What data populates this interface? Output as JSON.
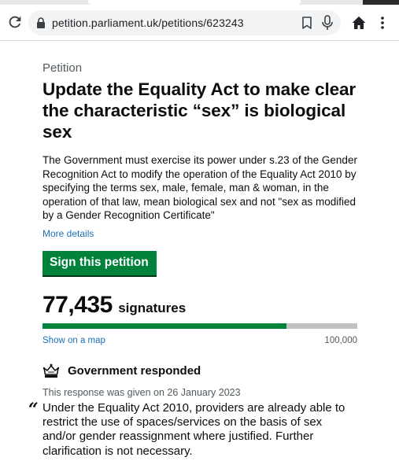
{
  "browser": {
    "url": "petition.parliament.uk/petitions/623243",
    "icons": [
      "reload-icon",
      "lock-icon",
      "bookmark-icon",
      "mic-icon",
      "home-icon",
      "more-vert-icon"
    ]
  },
  "petition": {
    "caption": "Petition",
    "title": "Update the Equality Act to make clear the characteristic “sex” is biological sex",
    "summary": "The Government must exercise its power under s.23 of the Gender Recognition Act to modify the operation of the Equality Act 2010 by specifying the terms sex, male, female, man & woman, in the operation of that law, mean biological sex and not \"sex as modified by a Gender Recognition Certificate\"",
    "more_details": "More details",
    "sign_button": "Sign this petition"
  },
  "signatures": {
    "count": "77,435",
    "label": "signatures",
    "progress": 0.77435,
    "show_map": "Show on a map",
    "goal": "100,000"
  },
  "government": {
    "heading": "Government responded",
    "date_text": "This response was given on 26 January 2023",
    "quote_mark": "“",
    "quote": "Under the Equality Act 2010, providers are already able to restrict the use of spaces/services on the basis of sex and/or gender reassignment where justified. Further clarification is not necessary."
  },
  "colors": {
    "accent_green": "#00823b",
    "link_blue": "#1d70b8",
    "text": "#0b0c0c",
    "muted": "#505a5f"
  }
}
